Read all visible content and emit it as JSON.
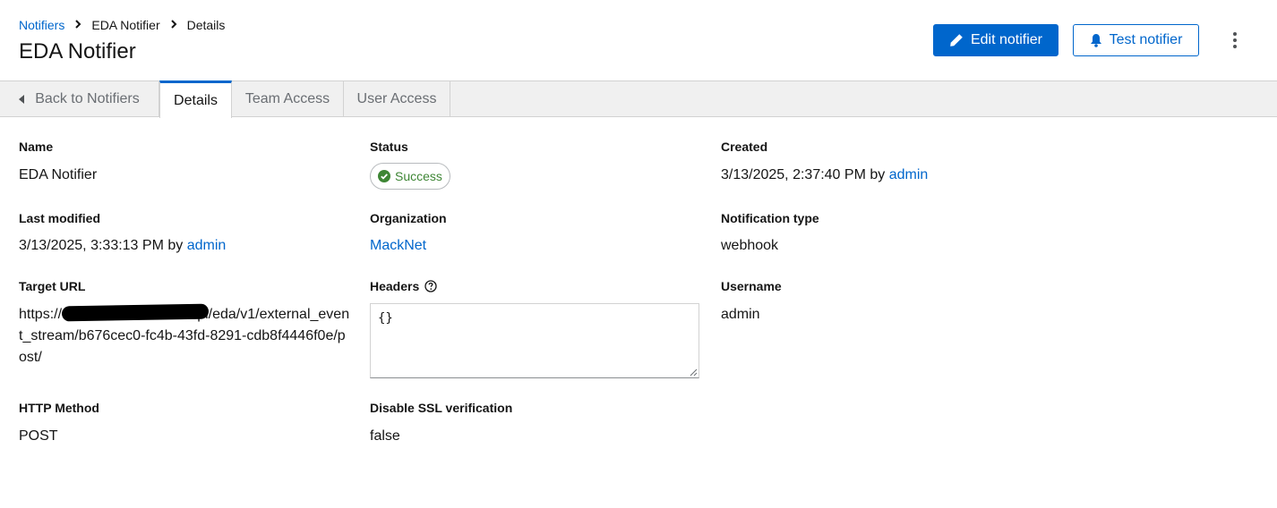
{
  "breadcrumb": {
    "root": "Notifiers",
    "parent": "EDA Notifier",
    "current": "Details"
  },
  "header": {
    "title": "EDA Notifier",
    "edit_label": "Edit notifier",
    "test_label": "Test notifier"
  },
  "tabs": {
    "back": "Back to Notifiers",
    "details": "Details",
    "team": "Team Access",
    "user": "User Access"
  },
  "details": {
    "name": {
      "label": "Name",
      "value": "EDA Notifier"
    },
    "status": {
      "label": "Status",
      "value": "Success"
    },
    "created": {
      "label": "Created",
      "date": "3/13/2025, 2:37:40 PM by ",
      "user": "admin"
    },
    "last_modified": {
      "label": "Last modified",
      "date": "3/13/2025, 3:33:13 PM by ",
      "user": "admin"
    },
    "organization": {
      "label": "Organization",
      "value": "MackNet"
    },
    "notification_type": {
      "label": "Notification type",
      "value": "webhook"
    },
    "target_url": {
      "label": "Target URL",
      "value": "https://                         eda-event-streams/api/eda/v1/external_event_stream/b676cec0-fc4b-43fd-8291-cdb8f4446f0e/post/"
    },
    "headers": {
      "label": "Headers",
      "value": "{}"
    },
    "username": {
      "label": "Username",
      "value": "admin"
    },
    "http_method": {
      "label": "HTTP Method",
      "value": "POST"
    },
    "disable_ssl": {
      "label": "Disable SSL verification",
      "value": "false"
    }
  },
  "colors": {
    "primary": "#0066cc",
    "success": "#3e8635",
    "tab_bg": "#f0f0f0"
  }
}
